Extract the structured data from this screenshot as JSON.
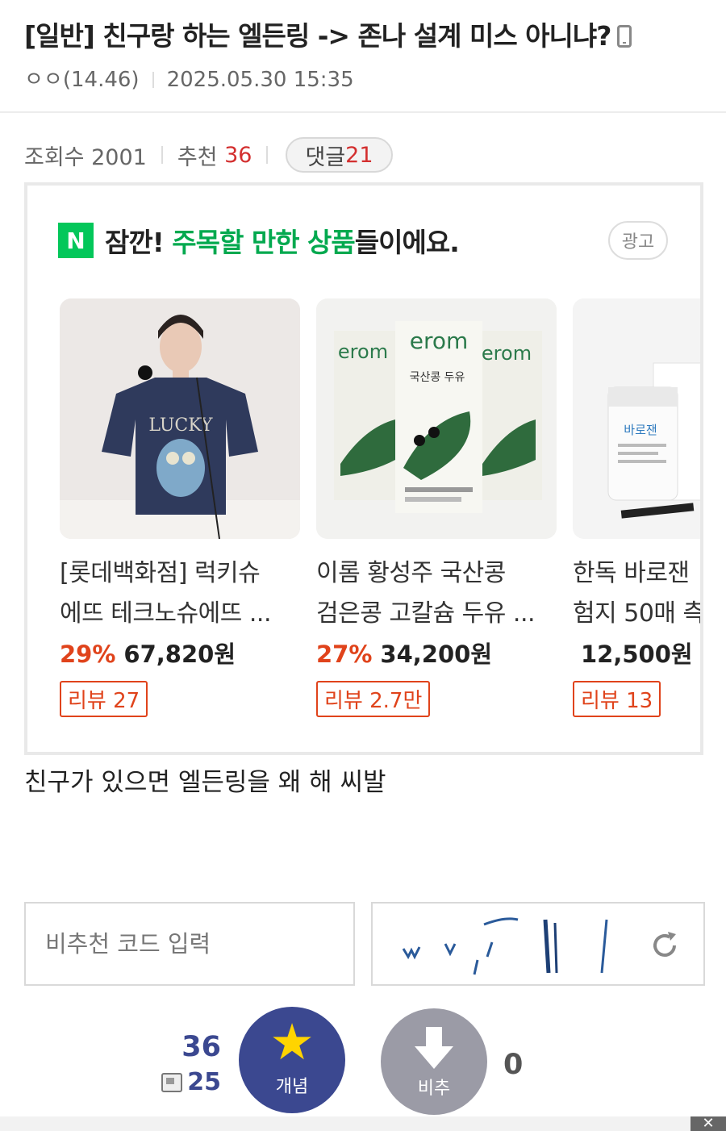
{
  "post": {
    "title": "[일반] 친구랑 하는 엘든링 -> 존나 설계 미스 아니냐?",
    "author": "ㅇㅇ(14.46)",
    "datetime": "2025.05.30 15:35",
    "views_label": "조회수 2001",
    "recommend_label": "추천",
    "recommend_count": "36",
    "comments_label": "댓글",
    "comments_count": "21",
    "body": "친구가 있으면 엘든링을 왜 해 씨발"
  },
  "ad": {
    "logo": "N",
    "headline_prefix": "잠깐! ",
    "headline_highlight": "주목할 만한 상품",
    "headline_suffix": "들이에요.",
    "badge": "광고",
    "products": [
      {
        "name_line1": "[롯데백화점] 럭키슈",
        "name_line2": "에뜨 테크노슈에뜨 ...",
        "discount": "29%",
        "price": "67,820원",
        "review": "리뷰 27",
        "image_text": "LUCKY"
      },
      {
        "name_line1": "이롬 황성주 국산콩",
        "name_line2": "검은콩 고칼슘 두유 ...",
        "discount": "27%",
        "price": "34,200원",
        "review": "리뷰 2.7만",
        "image_text": "erom",
        "image_subtext": "국산콩 두유"
      },
      {
        "name_line1": "한독 바로잰",
        "name_line2": "험지 50매 측",
        "discount": "",
        "price": "12,500원",
        "review": "리뷰 13",
        "image_text": "바로잰"
      }
    ]
  },
  "form": {
    "code_placeholder": "비추천 코드 입력",
    "captcha_glyphs": "w v 1 / | | /"
  },
  "vote": {
    "up_count": "36",
    "fix_count": "25",
    "up_label": "개념",
    "down_label": "비추",
    "down_count": "0"
  },
  "colors": {
    "accent_navy": "#3b4890",
    "naver_green": "#03c75a",
    "discount_red": "#e0431b",
    "recommend_red": "#d32f2f"
  }
}
